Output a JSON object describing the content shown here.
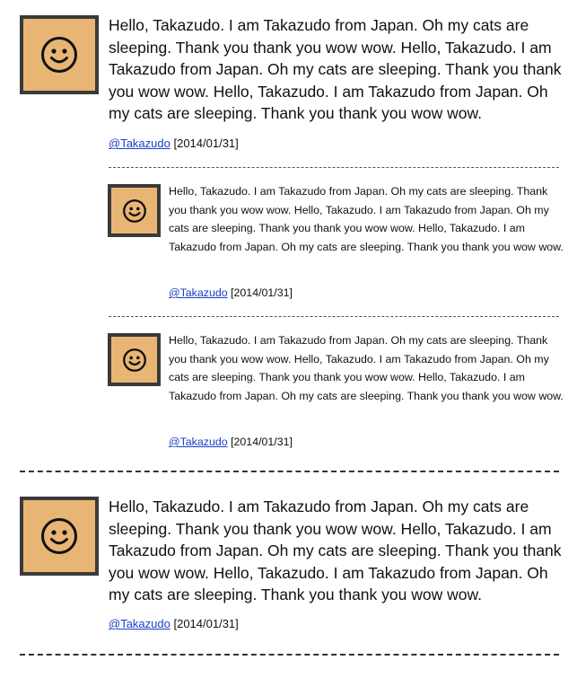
{
  "posts": [
    {
      "text": "Hello, Takazudo. I am Takazudo from Japan. Oh my cats are sleeping. Thank you thank you wow wow. Hello, Takazudo. I am Takazudo from Japan. Oh my cats are sleeping. Thank you thank you wow wow. Hello, Takazudo. I am Takazudo from Japan. Oh my cats are sleeping. Thank you thank you wow wow.",
      "author": "@Takazudo",
      "date": "[2014/01/31]",
      "replies": [
        {
          "text": "Hello, Takazudo. I am Takazudo from Japan. Oh my cats are sleeping. Thank you thank you wow wow. Hello, Takazudo. I am Takazudo from Japan. Oh my cats are sleeping. Thank you thank you wow wow. Hello, Takazudo. I am Takazudo from Japan. Oh my cats are sleeping. Thank you thank you wow wow.",
          "author": "@Takazudo",
          "date": "[2014/01/31]"
        },
        {
          "text": "Hello, Takazudo. I am Takazudo from Japan. Oh my cats are sleeping. Thank you thank you wow wow. Hello, Takazudo. I am Takazudo from Japan. Oh my cats are sleeping. Thank you thank you wow wow. Hello, Takazudo. I am Takazudo from Japan. Oh my cats are sleeping. Thank you thank you wow wow.",
          "author": "@Takazudo",
          "date": "[2014/01/31]"
        }
      ]
    },
    {
      "text": "Hello, Takazudo. I am Takazudo from Japan. Oh my cats are sleeping. Thank you thank you wow wow. Hello, Takazudo. I am Takazudo from Japan. Oh my cats are sleeping. Thank you thank you wow wow. Hello, Takazudo. I am Takazudo from Japan. Oh my cats are sleeping. Thank you thank you wow wow.",
      "author": "@Takazudo",
      "date": "[2014/01/31]"
    }
  ],
  "avatar_icon": "smiley-face-icon",
  "colors": {
    "avatar_bg": "#e9b575",
    "avatar_border": "#3a3a3a",
    "link": "#1a3fc8"
  }
}
